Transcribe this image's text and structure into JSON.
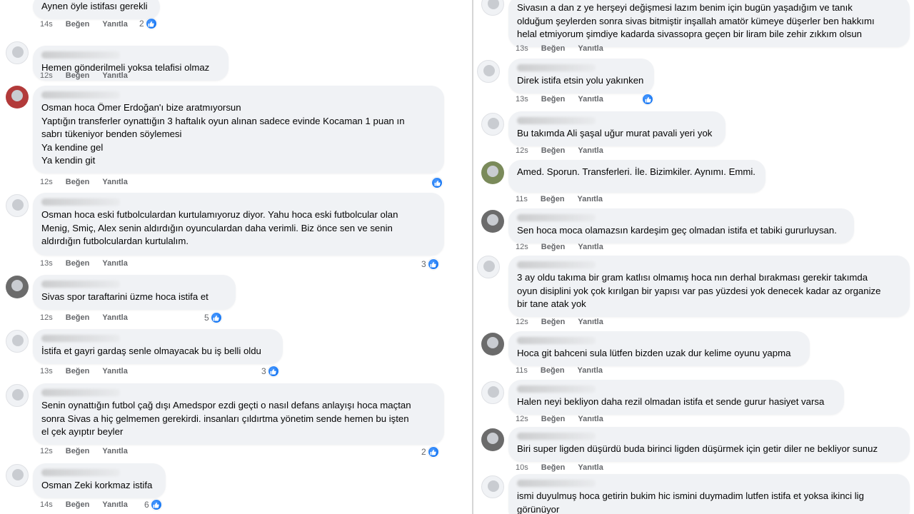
{
  "labels": {
    "like": "Beğen",
    "reply": "Yanıtla"
  },
  "left": [
    {
      "lines": [
        "Aynen öyle istifası gerekli"
      ],
      "time": "14s",
      "count": "2"
    },
    {
      "lines": [
        "Hemen gönderilmeli yoksa telafisi olmaz"
      ],
      "time": "12s",
      "count": ""
    },
    {
      "lines": [
        "Osman hoca Ömer Erdoğan'ı bize aratmıyorsun",
        "Yaptığın transferler oynattığın 3 haftalık oyun alınan sadece evinde Kocaman 1 puan ın",
        "sabrı tükeniyor benden söylemesi",
        "Ya kendine gel",
        "Ya kendin git"
      ],
      "time": "12s",
      "count": ""
    },
    {
      "lines": [
        "Osman hoca eski futbolculardan kurtulamıyoruz diyor. Yahu hoca eski futbolcular olan",
        "Menig, Smiç, Alex senin aldırdığın oyunculardan daha verimli. Biz önce sen ve senin",
        "aldırdığın futbolculardan kurtulalım."
      ],
      "time": "13s",
      "count": "3"
    },
    {
      "lines": [
        "Sivas spor taraftarini üzme hoca istifa et"
      ],
      "time": "12s",
      "count": "5"
    },
    {
      "lines": [
        "İstifa et gayri gardaş senle olmayacak bu iş belli oldu"
      ],
      "time": "13s",
      "count": "3"
    },
    {
      "lines": [
        "Senin oynattığın futbol çağ dışı Amedspor ezdi geçti o nasıl defans anlayışı hoca maçtan",
        "sonra Sivas a hiç gelmemen gerekirdi. insanları çıldırtma yönetim sende hemen bu işten",
        "el çek ayıptır beyler"
      ],
      "time": "12s",
      "count": "2"
    },
    {
      "lines": [
        "Osman Zeki korkmaz istifa"
      ],
      "time": "14s",
      "count": "6"
    }
  ],
  "right": [
    {
      "lines": [
        "Sivasın a dan z ye herşeyi değişmesi lazım benim için bugün yaşadığım ve tanık",
        "olduğum şeylerden sonra sivas bitmiştir inşallah amatör kümeye düşerler ben hakkımı",
        "helal etmiyorum şimdiye kadarda sivassopra geçen bir liram bile zehir zıkkım olsun"
      ],
      "time": "13s",
      "count": ""
    },
    {
      "lines": [
        "Direk istifa etsin yolu yakınken"
      ],
      "time": "13s",
      "count": ""
    },
    {
      "lines": [
        "Bu takımda Ali şaşal uğur murat pavali yeri yok"
      ],
      "time": "12s",
      "count": ""
    },
    {
      "lines": [
        "Amed. Sporun. Transferleri. İle. Bizimkiler. Aynımı. Emmi."
      ],
      "time": "11s",
      "count": ""
    },
    {
      "lines": [
        "Sen hoca moca olamazsın kardeşim geç olmadan istifa et tabiki gururluysan."
      ],
      "time": "12s",
      "count": ""
    },
    {
      "lines": [
        "3 ay oldu takıma bir gram katlısı olmamış hoca nın derhal bırakması gerekir takımda",
        "oyun disiplini yok çok kırılgan bir yapısı var pas yüzdesi yok denecek kadar az organize",
        "bir tane atak yok"
      ],
      "time": "12s",
      "count": ""
    },
    {
      "lines": [
        "Hoca git bahceni sula lütfen bizden uzak dur kelime oyunu yapma"
      ],
      "time": "11s",
      "count": ""
    },
    {
      "lines": [
        "Halen neyi bekliyon daha rezil olmadan istifa et sende gurur hasiyet varsa"
      ],
      "time": "12s",
      "count": ""
    },
    {
      "lines": [
        "Biri super ligden düşürdü buda birinci ligden düşürmek için getir diler ne bekliyor sunuz"
      ],
      "time": "10s",
      "count": ""
    },
    {
      "lines": [
        "ismi duyulmuş hoca getirin bukim hic ismini duymadim lutfen istifa et yoksa ikinci lig",
        "görünüyor"
      ],
      "time": "",
      "count": ""
    }
  ]
}
